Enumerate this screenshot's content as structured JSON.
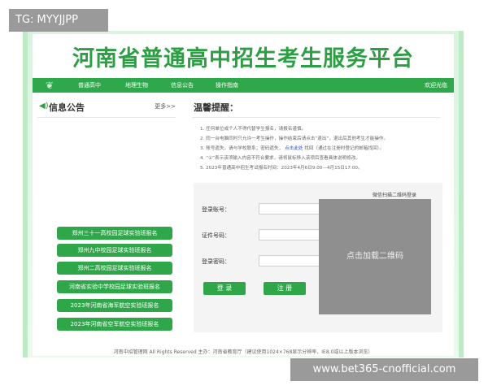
{
  "overlay_tag": "TG: MYYJJPP",
  "header": {
    "title": "河南省普通高中招生考生服务平台"
  },
  "nav": {
    "items": [
      "普通高中",
      "地理生物",
      "信息公告",
      "操作指南"
    ],
    "welcome": "欢迎光临"
  },
  "info": {
    "title": "信息公告",
    "more": "更多>>",
    "buttons": [
      "郑州三十一高校园足球实验班报名",
      "郑州九中校园足球实验班报名",
      "郑州二高校园足球实验班报名",
      "河南省实验中学校园足球实验班报名",
      "2023年河南省海军航空实验班报名",
      "2023年河南省空军航空实验班报名"
    ]
  },
  "tips": {
    "title": "温馨提醒：",
    "lines": [
      "1. 任何单位或个人不得代替学生报名，请报名谨慎。",
      "2. 同一台电脑同时只允许一考生操作，操作结束后请点击“退出”，退出后其他考生才能操作。",
      "3. 账号遗失，请与学校联系；密码遗失，",
      "4. “①”表示该项输入内容不符合要求，请将鼠标移入该项后查看具体说明修改。",
      "5. 2023年普通高中招生考试报名时间：2023年4月6日9:00—4月15日17:00。"
    ],
    "line3_link": "点击此处",
    "line3_tail": "找回（通过在注册时登记的邮箱找回）。"
  },
  "login": {
    "account_label": "登录账号：",
    "id_label": "证件号码：",
    "password_label": "登录密码：",
    "login_btn": "登 录",
    "register_btn": "注 册",
    "qr_label": "微信扫描二维码登录",
    "qr_load": "点击加载二维码"
  },
  "footer": {
    "text": "河南中招管理网 All Rights Reserved 主办：河南省教育厅（建议使用1024×768显示分辨率，IE8.0或以上版本浏览）"
  },
  "watermark": "www.bet365-cnofficial.com",
  "colors": {
    "brand_green": "#2fa84b",
    "title_green": "#2c9e43",
    "qr_gray": "#8f8f8f"
  }
}
